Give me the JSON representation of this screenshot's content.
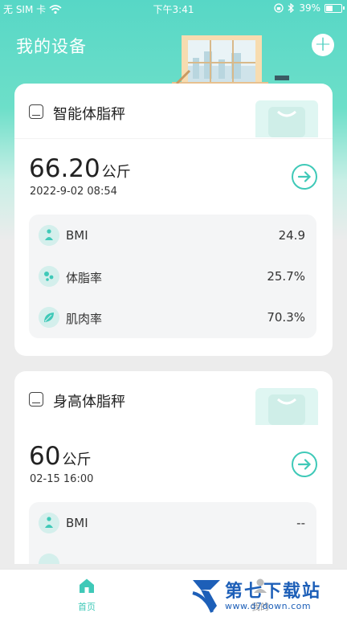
{
  "status_bar": {
    "carrier": "无 SIM 卡",
    "time": "下午3:41",
    "battery": "39%",
    "battery_level": 0.39
  },
  "header": {
    "title": "我的设备",
    "add_icon": "plus-icon"
  },
  "devices": [
    {
      "name": "智能体脂秤",
      "weight_value": "66.20",
      "weight_unit": "公斤",
      "time": "2022-9-02 08:54",
      "metrics": [
        {
          "label": "BMI",
          "value": "24.9",
          "icon": "person-icon"
        },
        {
          "label": "体脂率",
          "value": "25.7%",
          "icon": "bubbles-icon"
        },
        {
          "label": "肌肉率",
          "value": "70.3%",
          "icon": "leaf-icon"
        }
      ]
    },
    {
      "name": "身高体脂秤",
      "weight_value": "60",
      "weight_unit": "公斤",
      "time": "02-15 16:00",
      "metrics": [
        {
          "label": "BMI",
          "value": "--",
          "icon": "person-icon"
        }
      ]
    }
  ],
  "tabbar": {
    "home_label": "首页",
    "me_label": "我的"
  },
  "watermark": {
    "brand": "第七下载站",
    "url": "www.d7down.com"
  },
  "colors": {
    "accent": "#3fc9b8",
    "hero_top": "#57d7c6",
    "card_bg": "#ffffff",
    "metric_bg": "#f4f5f6"
  }
}
